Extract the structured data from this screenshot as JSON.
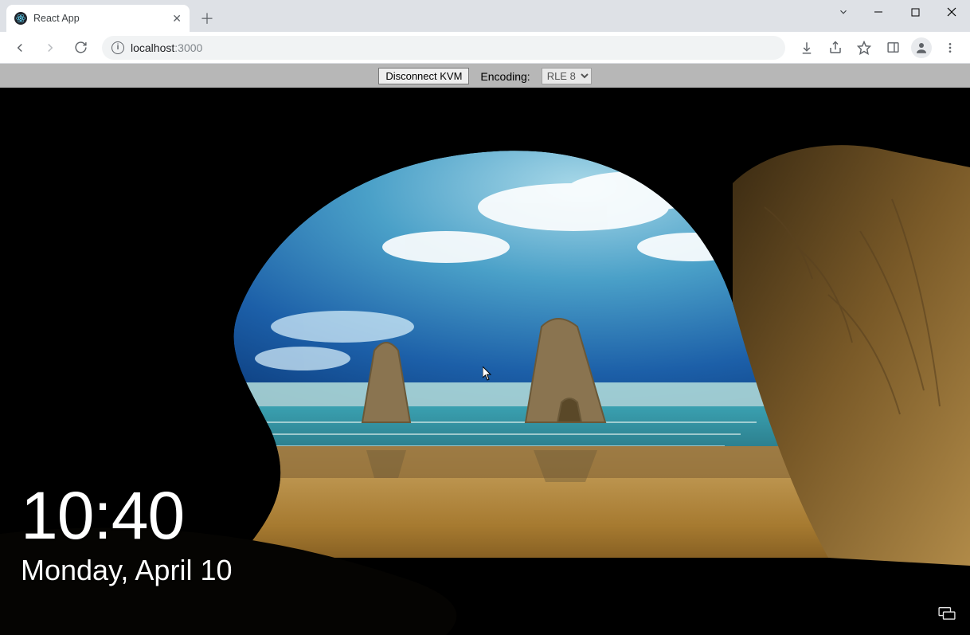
{
  "browser": {
    "tab_title": "React App",
    "address_host": "localhost",
    "address_port": ":3000"
  },
  "kvm": {
    "disconnect_label": "Disconnect KVM",
    "encoding_label": "Encoding:",
    "encoding_selected": "RLE 8"
  },
  "lockscreen": {
    "time": "10:40",
    "date": "Monday, April 10"
  }
}
